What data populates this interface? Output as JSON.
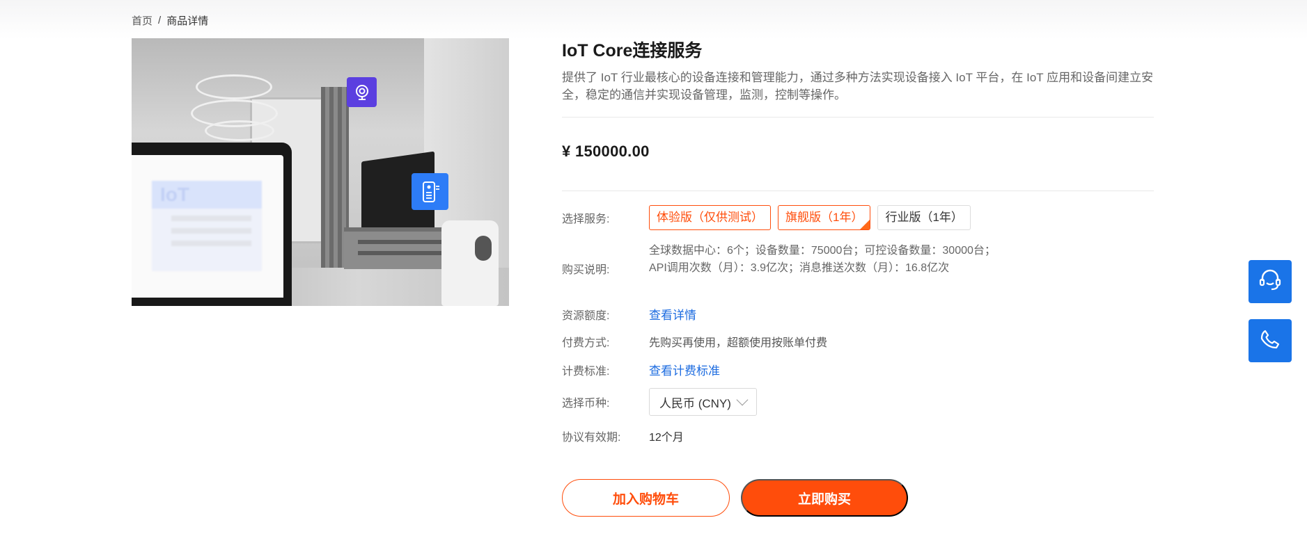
{
  "breadcrumb": {
    "home": "首页",
    "separator": "/",
    "current": "商品详情"
  },
  "product": {
    "title": "IoT Core连接服务",
    "description": "提供了 IoT 行业最核心的设备连接和管理能力，通过多种方法实现设备接入 IoT 平台，在 IoT 应用和设备间建立安全，稳定的通信并实现设备管理，监测，控制等操作。",
    "price": "¥ 150000.00",
    "hero_card_text": "IoT"
  },
  "service": {
    "label": "选择服务:",
    "options": [
      {
        "label": "体验版（仅供测试）",
        "state": "selected"
      },
      {
        "label": "旗舰版（1年）",
        "state": "selected-checked"
      },
      {
        "label": "行业版（1年）",
        "state": "default"
      }
    ]
  },
  "purchase_note": {
    "label": "购买说明:",
    "text": "全球数据中心：6个；设备数量：75000台；可控设备数量：30000台；API调用次数（月）：3.9亿次；消息推送次数（月）：16.8亿次"
  },
  "quota": {
    "label": "资源额度:",
    "link": "查看详情"
  },
  "payment": {
    "label": "付费方式:",
    "text": "先购买再使用，超额使用按账单付费"
  },
  "billing": {
    "label": "计费标准:",
    "link": "查看计费标准"
  },
  "currency": {
    "label": "选择币种:",
    "value": "人民币 (CNY)"
  },
  "validity": {
    "label": "协议有效期:",
    "value": "12个月"
  },
  "actions": {
    "cart": "加入购物车",
    "buy": "立即购买"
  },
  "colors": {
    "accent": "#ff4d0b",
    "link": "#1d6ce0",
    "float_button": "#1a74e8"
  },
  "icons": {
    "support": "headset-icon",
    "phone": "phone-icon",
    "camera": "camera-icon",
    "remote": "remote-icon"
  }
}
